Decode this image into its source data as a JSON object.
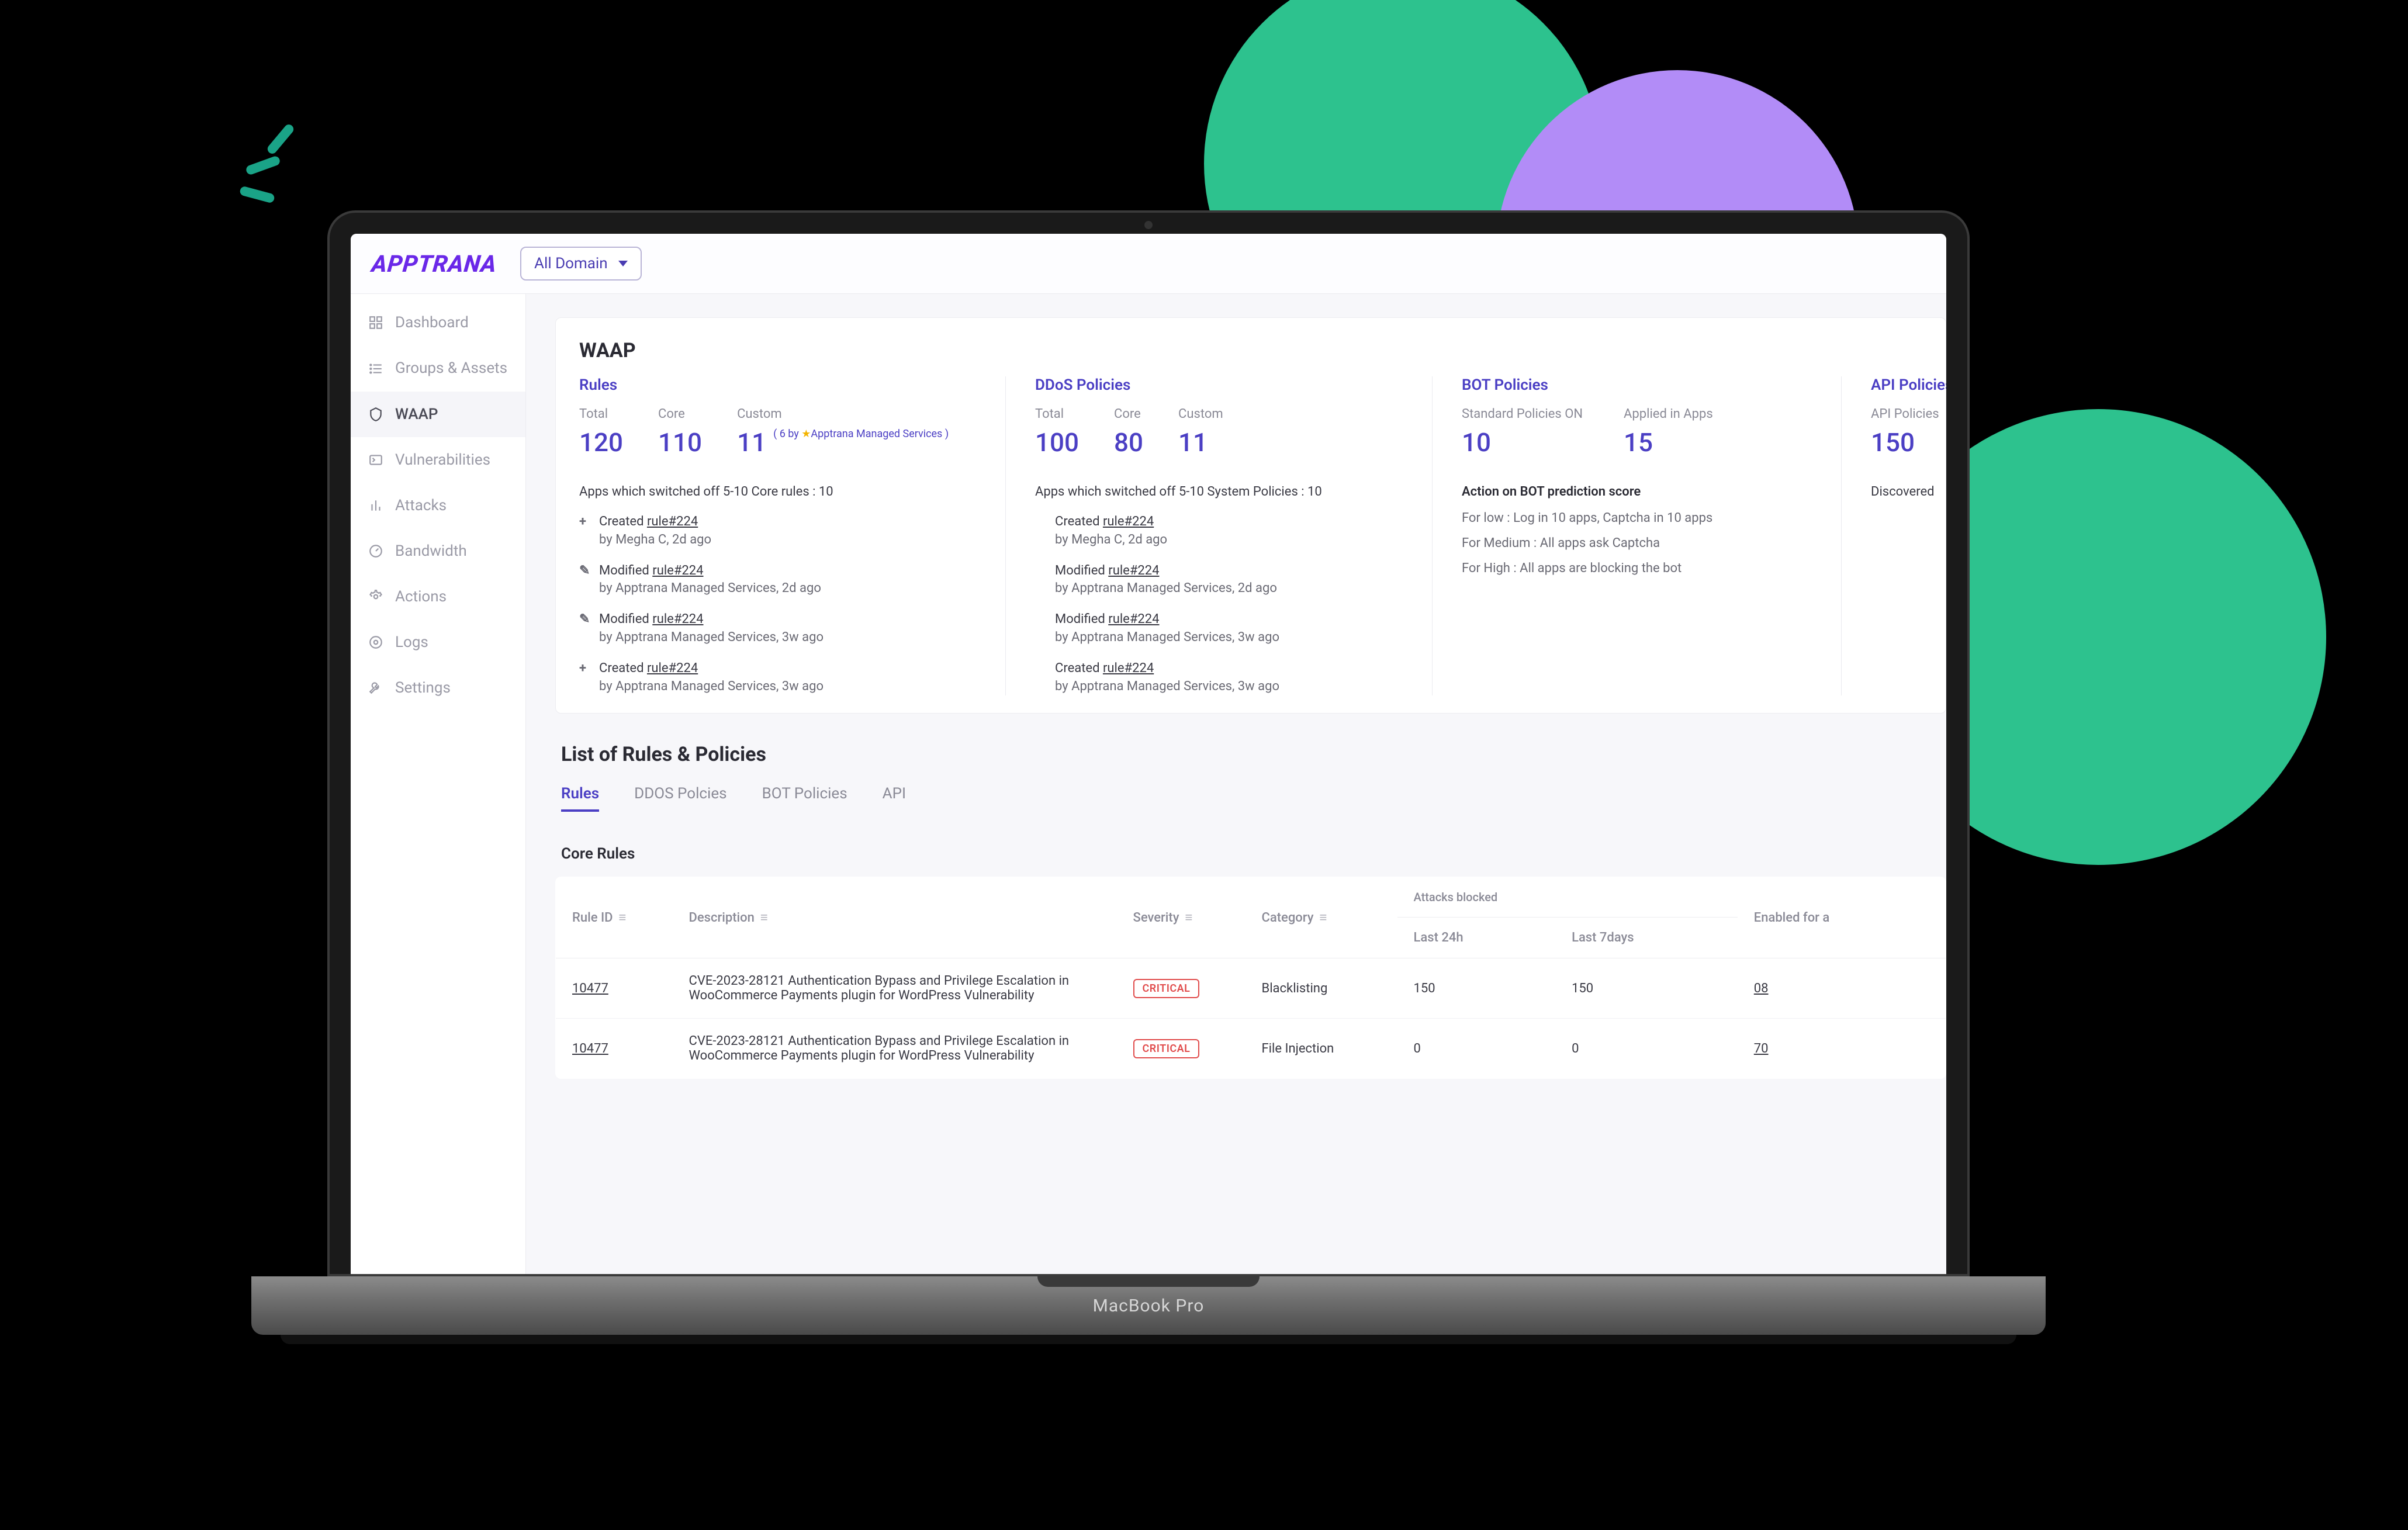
{
  "brand": "APPTRANA",
  "domain_selector": {
    "label": "All Domain"
  },
  "sidebar": {
    "items": [
      {
        "label": "Dashboard",
        "active": false
      },
      {
        "label": "Groups & Assets",
        "active": false
      },
      {
        "label": "WAAP",
        "active": true
      },
      {
        "label": "Vulnerabilities",
        "active": false
      },
      {
        "label": "Attacks",
        "active": false
      },
      {
        "label": "Bandwidth",
        "active": false
      },
      {
        "label": "Actions",
        "active": false
      },
      {
        "label": "Logs",
        "active": false
      },
      {
        "label": "Settings",
        "active": false
      }
    ]
  },
  "waap": {
    "title": "WAAP",
    "rules": {
      "heading": "Rules",
      "total_label": "Total",
      "total": "120",
      "core_label": "Core",
      "core": "110",
      "custom_label": "Custom",
      "custom": "11",
      "custom_note_prefix": "( 6 by ",
      "custom_note_mid": "Apptrana Managed Services )",
      "switched_off": "Apps which switched off 5-10 Core rules : 10",
      "activity": [
        {
          "icon": "+",
          "action": "Created",
          "rule": "rule#224",
          "by": "by Megha C, 2d ago"
        },
        {
          "icon": "✎",
          "action": "Modified",
          "rule": "rule#224",
          "by": "by Apptrana Managed Services, 2d ago"
        },
        {
          "icon": "✎",
          "action": "Modified",
          "rule": "rule#224",
          "by": "by Apptrana Managed Services, 3w ago"
        },
        {
          "icon": "+",
          "action": "Created",
          "rule": "rule#224",
          "by": "by Apptrana Managed Services, 3w ago"
        }
      ]
    },
    "ddos": {
      "heading": "DDoS Policies",
      "total_label": "Total",
      "total": "100",
      "core_label": "Core",
      "core": "80",
      "custom_label": "Custom",
      "custom": "11",
      "switched_off": "Apps which switched off 5-10 System Policies : 10",
      "activity": [
        {
          "icon": "",
          "action": "Created",
          "rule": "rule#224",
          "by": "by Megha C, 2d ago"
        },
        {
          "icon": "",
          "action": "Modified",
          "rule": "rule#224",
          "by": "by Apptrana Managed Services, 2d ago"
        },
        {
          "icon": "",
          "action": "Modified",
          "rule": "rule#224",
          "by": "by Apptrana Managed Services, 3w ago"
        },
        {
          "icon": "",
          "action": "Created",
          "rule": "rule#224",
          "by": "by Apptrana Managed Services, 3w ago"
        }
      ]
    },
    "bot": {
      "heading": "BOT Policies",
      "std_label": "Standard Policies ON",
      "std": "10",
      "apps_label": "Applied in Apps",
      "apps": "15",
      "action_head": "Action on BOT prediction score",
      "lines": [
        "For low : Log in 10 apps, Captcha in 10 apps",
        "For Medium : All apps ask Captcha",
        "For High : All apps are blocking the bot"
      ]
    },
    "api": {
      "heading": "API Policies",
      "p_label": "API Policies",
      "p_val": "150",
      "disc_label": "Discovered"
    }
  },
  "list": {
    "title": "List of Rules & Policies",
    "tabs": [
      "Rules",
      "DDOS Polcies",
      "BOT Policies",
      "API"
    ],
    "active_tab": 0,
    "subhead": "Core Rules",
    "columns": {
      "rule_id": "Rule ID",
      "description": "Description",
      "severity": "Severity",
      "category": "Category",
      "attacks_blocked": "Attacks blocked",
      "last24": "Last 24h",
      "last7": "Last 7days",
      "enabled": "Enabled for a"
    },
    "rows": [
      {
        "id": "10477",
        "desc": "CVE-2023-28121 Authentication Bypass and Privilege Escalation in WooCommerce Payments plugin for WordPress Vulnerability",
        "severity": "CRITICAL",
        "category": "Blacklisting",
        "a24": "150",
        "a7": "150",
        "enabled": "08"
      },
      {
        "id": "10477",
        "desc": "CVE-2023-28121 Authentication Bypass and Privilege Escalation in WooCommerce Payments plugin for WordPress Vulnerability",
        "severity": "CRITICAL",
        "category": "File Injection",
        "a24": "0",
        "a7": "0",
        "enabled": "70"
      }
    ]
  },
  "laptop_label": "MacBook Pro"
}
